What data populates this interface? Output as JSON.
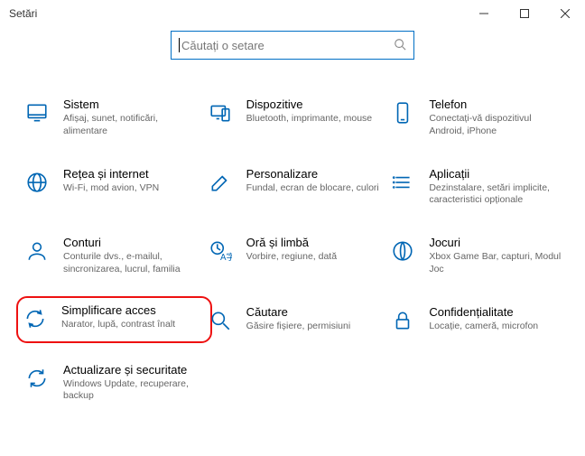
{
  "window": {
    "title": "Setări"
  },
  "search": {
    "placeholder": "Căutați o setare"
  },
  "tiles": {
    "system": {
      "title": "Sistem",
      "subtitle": "Afișaj, sunet, notificări, alimentare"
    },
    "devices": {
      "title": "Dispozitive",
      "subtitle": "Bluetooth, imprimante, mouse"
    },
    "phone": {
      "title": "Telefon",
      "subtitle": "Conectați-vă dispozitivul Android, iPhone"
    },
    "network": {
      "title": "Rețea și internet",
      "subtitle": "Wi-Fi, mod avion, VPN"
    },
    "personalize": {
      "title": "Personalizare",
      "subtitle": "Fundal, ecran de blocare, culori"
    },
    "apps": {
      "title": "Aplicații",
      "subtitle": "Dezinstalare, setări implicite, caracteristici opționale"
    },
    "accounts": {
      "title": "Conturi",
      "subtitle": "Conturile dvs., e-mailul, sincronizarea, lucrul, familia"
    },
    "timelang": {
      "title": "Oră și limbă",
      "subtitle": "Vorbire, regiune, dată"
    },
    "gaming": {
      "title": "Jocuri",
      "subtitle": "Xbox Game Bar, capturi, Modul Joc"
    },
    "ease": {
      "title": "Simplificare acces",
      "subtitle": "Narator, lupă, contrast înalt"
    },
    "searchcat": {
      "title": "Căutare",
      "subtitle": "Găsire fișiere, permisiuni"
    },
    "privacy": {
      "title": "Confidențialitate",
      "subtitle": "Locație, cameră, microfon"
    },
    "update": {
      "title": "Actualizare și securitate",
      "subtitle": "Windows Update, recuperare, backup"
    }
  }
}
